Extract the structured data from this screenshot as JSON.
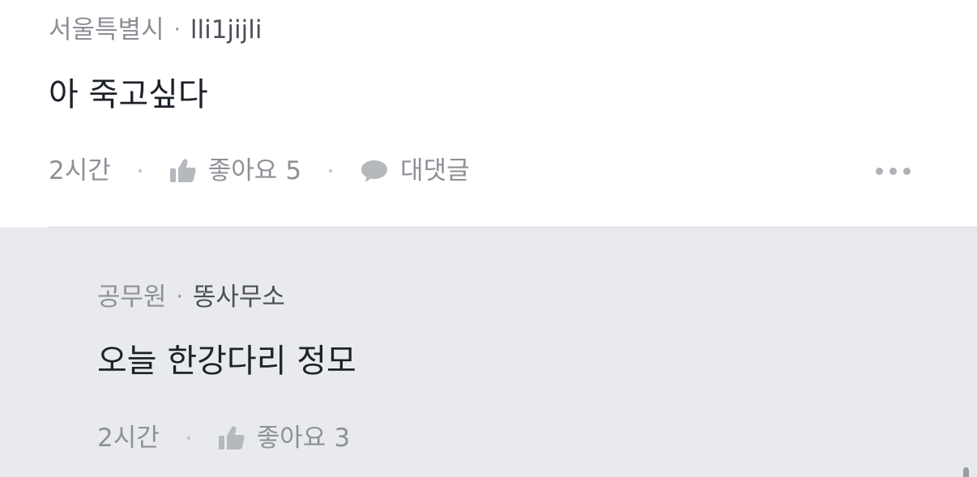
{
  "comments": [
    {
      "region": "서울특별시",
      "separator": "·",
      "nickname": "lli1jijli",
      "text": "아 죽고싶다",
      "time": "2시간",
      "like_label": "좋아요",
      "like_count": "5",
      "reply_label": "대댓글",
      "more_icon": "more-dots-icon"
    },
    {
      "region": "공무원",
      "separator": "·",
      "nickname": "똥사무소",
      "text": "오늘 한강다리 정모",
      "time": "2시간",
      "like_label": "좋아요",
      "like_count": "3"
    }
  ],
  "icons": {
    "like": "thumbs-up-icon",
    "reply": "speech-bubble-icon"
  },
  "colors": {
    "reply_background": "#e9eaee",
    "muted_text": "#8d9096",
    "primary_text": "#1d2129",
    "icon": "#b5b8bd"
  }
}
